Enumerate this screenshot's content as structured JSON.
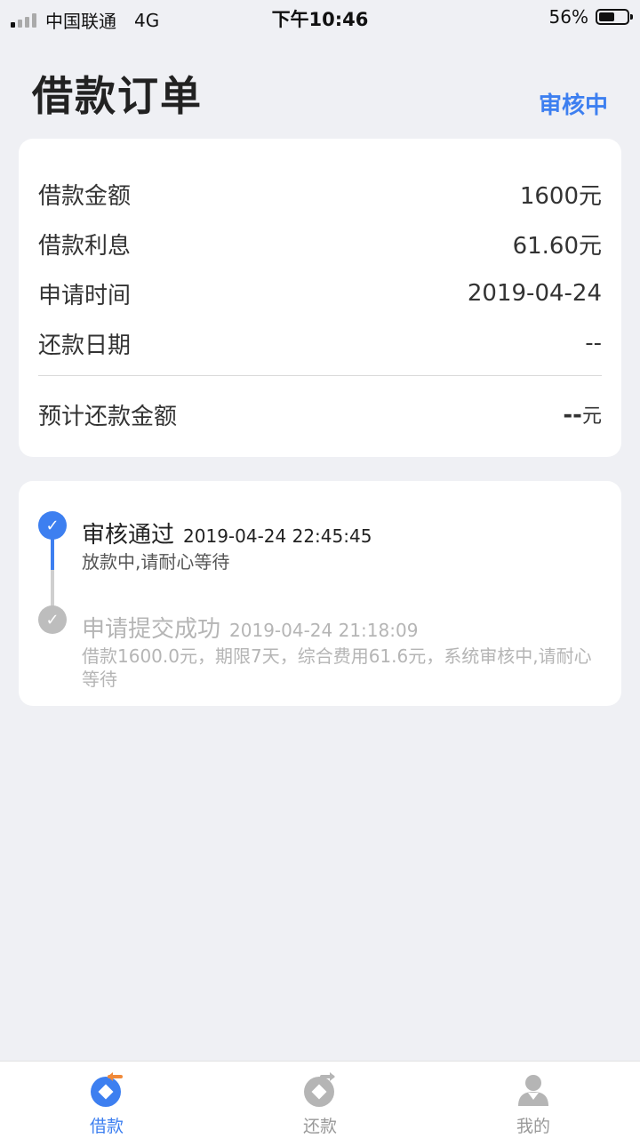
{
  "status_bar": {
    "carrier": "中国联通",
    "network": "4G",
    "time": "下午10:46",
    "battery_text": "56%",
    "battery_level": 0.56
  },
  "header": {
    "title": "借款订单",
    "status": "审核中"
  },
  "summary": {
    "rows": [
      {
        "label": "借款金额",
        "value": "1600元"
      },
      {
        "label": "借款利息",
        "value": "61.60元"
      },
      {
        "label": "申请时间",
        "value": "2019-04-24"
      },
      {
        "label": "还款日期",
        "value": "--"
      }
    ],
    "total": {
      "label": "预计还款金额",
      "value": "--",
      "unit": "元"
    }
  },
  "timeline": [
    {
      "title": "审核通过",
      "time": "2019-04-24 22:45:45",
      "desc": "放款中,请耐心等待",
      "active": true
    },
    {
      "title": "申请提交成功",
      "time": "2019-04-24 21:18:09",
      "desc": "借款1600.0元，期限7天，综合费用61.6元，系统审核中,请耐心等待",
      "active": false
    }
  ],
  "tabbar": {
    "items": [
      {
        "label": "借款",
        "icon": "borrow-icon",
        "active": true
      },
      {
        "label": "还款",
        "icon": "repay-icon",
        "active": false
      },
      {
        "label": "我的",
        "icon": "profile-icon",
        "active": false
      }
    ]
  },
  "colors": {
    "accent": "#3d7ff0",
    "accent_orange": "#f08a3a",
    "muted": "#b5b5b5",
    "background": "#eff0f4"
  }
}
